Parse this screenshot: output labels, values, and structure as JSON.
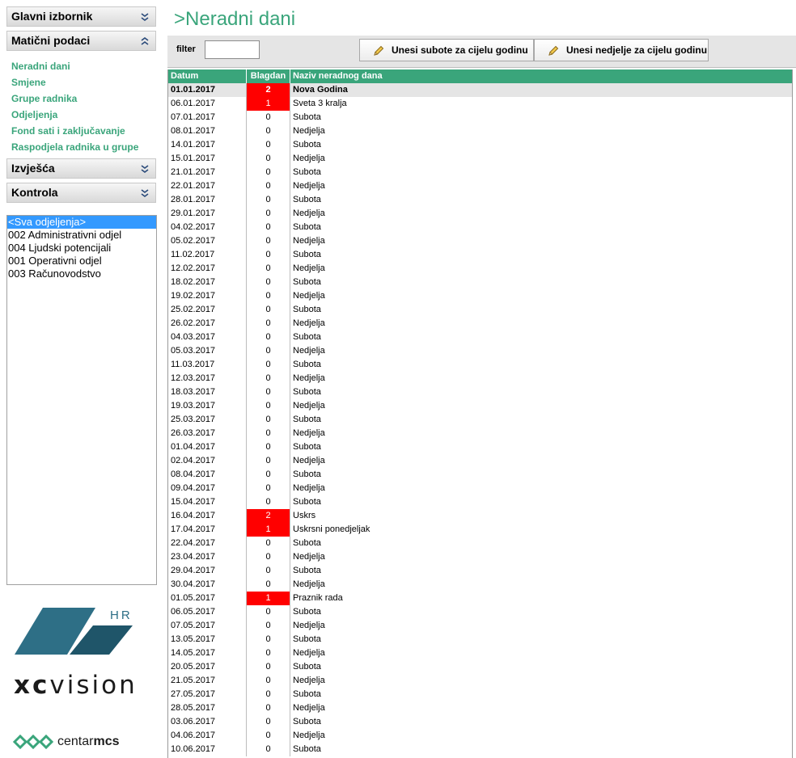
{
  "sidebar": {
    "sections": {
      "main_menu": "Glavni izbornik",
      "master_data": "Matični podaci",
      "reports": "Izvješća",
      "control": "Kontrola"
    },
    "master_links": [
      "Neradni dani",
      "Smjene",
      "Grupe radnika",
      "Odjeljenja",
      "Fond sati i zaključavanje",
      "Raspodjela radnika u grupe"
    ],
    "departments": [
      "<Sva odjeljenja>",
      "002 Administrativni odjel",
      "004 Ljudski potencijali",
      "001 Operativni odjel",
      "003 Računovodstvo"
    ],
    "selected_department": "<Sva odjeljenja>",
    "logos": {
      "hr": "HR",
      "xc": "xc",
      "vision": "vision",
      "centar": "centar",
      "mcs": "mcs"
    }
  },
  "page": {
    "title": ">Neradni dani"
  },
  "toolbar": {
    "filter_label": "filter",
    "filter_value": "",
    "btn_saturdays": "Unesi subote za cijelu godinu",
    "btn_sundays": "Unesi nedjelje za cijelu godinu"
  },
  "grid": {
    "columns": [
      "Datum",
      "Blagdan",
      "Naziv neradnog dana"
    ],
    "rows": [
      [
        "01.01.2017",
        "2",
        "Nova Godina"
      ],
      [
        "06.01.2017",
        "1",
        "Sveta 3 kralja"
      ],
      [
        "07.01.2017",
        "0",
        "Subota"
      ],
      [
        "08.01.2017",
        "0",
        "Nedjelja"
      ],
      [
        "14.01.2017",
        "0",
        "Subota"
      ],
      [
        "15.01.2017",
        "0",
        "Nedjelja"
      ],
      [
        "21.01.2017",
        "0",
        "Subota"
      ],
      [
        "22.01.2017",
        "0",
        "Nedjelja"
      ],
      [
        "28.01.2017",
        "0",
        "Subota"
      ],
      [
        "29.01.2017",
        "0",
        "Nedjelja"
      ],
      [
        "04.02.2017",
        "0",
        "Subota"
      ],
      [
        "05.02.2017",
        "0",
        "Nedjelja"
      ],
      [
        "11.02.2017",
        "0",
        "Subota"
      ],
      [
        "12.02.2017",
        "0",
        "Nedjelja"
      ],
      [
        "18.02.2017",
        "0",
        "Subota"
      ],
      [
        "19.02.2017",
        "0",
        "Nedjelja"
      ],
      [
        "25.02.2017",
        "0",
        "Subota"
      ],
      [
        "26.02.2017",
        "0",
        "Nedjelja"
      ],
      [
        "04.03.2017",
        "0",
        "Subota"
      ],
      [
        "05.03.2017",
        "0",
        "Nedjelja"
      ],
      [
        "11.03.2017",
        "0",
        "Subota"
      ],
      [
        "12.03.2017",
        "0",
        "Nedjelja"
      ],
      [
        "18.03.2017",
        "0",
        "Subota"
      ],
      [
        "19.03.2017",
        "0",
        "Nedjelja"
      ],
      [
        "25.03.2017",
        "0",
        "Subota"
      ],
      [
        "26.03.2017",
        "0",
        "Nedjelja"
      ],
      [
        "01.04.2017",
        "0",
        "Subota"
      ],
      [
        "02.04.2017",
        "0",
        "Nedjelja"
      ],
      [
        "08.04.2017",
        "0",
        "Subota"
      ],
      [
        "09.04.2017",
        "0",
        "Nedjelja"
      ],
      [
        "15.04.2017",
        "0",
        "Subota"
      ],
      [
        "16.04.2017",
        "2",
        "Uskrs"
      ],
      [
        "17.04.2017",
        "1",
        "Uskrsni ponedjeljak"
      ],
      [
        "22.04.2017",
        "0",
        "Subota"
      ],
      [
        "23.04.2017",
        "0",
        "Nedjelja"
      ],
      [
        "29.04.2017",
        "0",
        "Subota"
      ],
      [
        "30.04.2017",
        "0",
        "Nedjelja"
      ],
      [
        "01.05.2017",
        "1",
        "Praznik rada"
      ],
      [
        "06.05.2017",
        "0",
        "Subota"
      ],
      [
        "07.05.2017",
        "0",
        "Nedjelja"
      ],
      [
        "13.05.2017",
        "0",
        "Subota"
      ],
      [
        "14.05.2017",
        "0",
        "Nedjelja"
      ],
      [
        "20.05.2017",
        "0",
        "Subota"
      ],
      [
        "21.05.2017",
        "0",
        "Nedjelja"
      ],
      [
        "27.05.2017",
        "0",
        "Subota"
      ],
      [
        "28.05.2017",
        "0",
        "Nedjelja"
      ],
      [
        "03.06.2017",
        "0",
        "Subota"
      ],
      [
        "04.06.2017",
        "0",
        "Nedjelja"
      ],
      [
        "10.06.2017",
        "0",
        "Subota"
      ]
    ]
  },
  "colors": {
    "accent_green": "#3aa57b",
    "holiday_red": "#ff0000",
    "selection_blue": "#3399ff",
    "logo_teal": "#2e6f86"
  }
}
